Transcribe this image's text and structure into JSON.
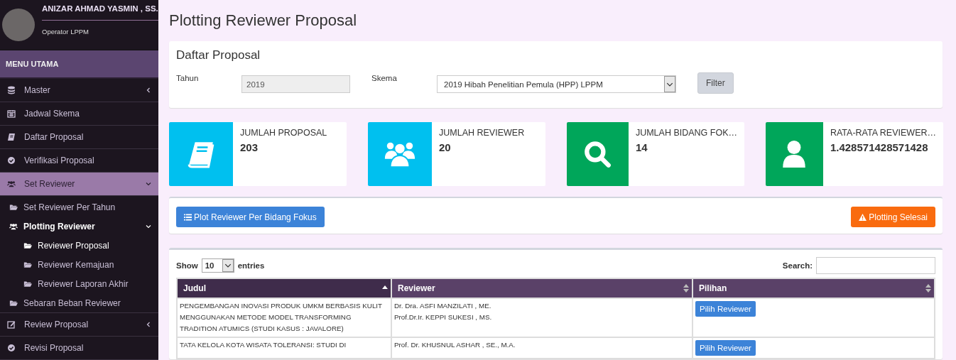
{
  "user": {
    "name": "ANIZAR AHMAD YASMIN , SS.",
    "role": "Operator LPPM"
  },
  "sidebar": {
    "header": "MENU UTAMA",
    "items": [
      {
        "label": "Master",
        "selected": false,
        "expanded": false
      },
      {
        "label": "Jadwal Skema",
        "selected": false
      },
      {
        "label": "Daftar Proposal",
        "selected": false
      },
      {
        "label": "Verifikasi Proposal",
        "selected": false
      },
      {
        "label": "Set Reviewer",
        "selected": true,
        "expanded": true,
        "children": [
          {
            "label": "Set Reviewer Per Tahun",
            "selected": false
          },
          {
            "label": "Plotting Reviewer",
            "selected": true,
            "expanded": true,
            "children": [
              {
                "label": "Reviewer Proposal",
                "selected": true
              },
              {
                "label": "Reviewer Kemajuan",
                "selected": false
              },
              {
                "label": "Reviewer Laporan Akhir",
                "selected": false
              }
            ]
          },
          {
            "label": "Sebaran Beban Reviewer",
            "selected": false
          }
        ]
      },
      {
        "label": "Review Proposal",
        "selected": false,
        "expanded": false
      },
      {
        "label": "Revisi Proposal",
        "selected": false
      }
    ]
  },
  "page_title": "Plotting Reviewer Proposal",
  "filter": {
    "title": "Daftar Proposal",
    "year_label": "Tahun",
    "year_value": "2019",
    "scheme_label": "Skema",
    "scheme_value": "2019 Hibah Penelitian Pemula (HPP) LPPM",
    "button": "Filter"
  },
  "stats": [
    {
      "label": "JUMLAH PROPOSAL",
      "value": "203",
      "color": "#00c0ef"
    },
    {
      "label": "JUMLAH REVIEWER",
      "value": "20",
      "color": "#00c0ef"
    },
    {
      "label": "JUMLAH BIDANG FOK…",
      "value": "14",
      "color": "#00a65a"
    },
    {
      "label": "RATA-RATA REVIEWER…",
      "value": "1.428571428571428",
      "color": "#00a65a"
    }
  ],
  "actions": {
    "plot_button": "Plot Reviewer Per Bidang Fokus",
    "done_button": "Plotting Selesai"
  },
  "table": {
    "show_label": "Show",
    "page_size": "10",
    "entries_label": "entries",
    "search_label": "Search:",
    "columns": [
      {
        "label": "Judul",
        "sorted": true
      },
      {
        "label": "Reviewer",
        "sorted": false
      },
      {
        "label": "Pilihan",
        "sorted": false
      }
    ],
    "rows": [
      {
        "judul": "PENGEMBANGAN INOVASI PRODUK UMKM BERBASIS KULIT MENGGUNAKAN METODE MODEL TRANSFORMING TRADITION ATUMICS (STUDI KASUS : JAVALORE)",
        "reviewers": [
          "Dr. Dra. ASFI MANZILATI , ME.",
          "Prof.Dr.Ir. KEPPI SUKESI , MS."
        ],
        "button": "Pilih Reviewer"
      },
      {
        "judul": "TATA KELOLA KOTA WISATA TOLERANSI: STUDI DI",
        "reviewers": [
          "Prof. Dr. KHUSNUL ASHAR , SE., M.A."
        ],
        "button": "Pilih Reviewer"
      }
    ]
  }
}
